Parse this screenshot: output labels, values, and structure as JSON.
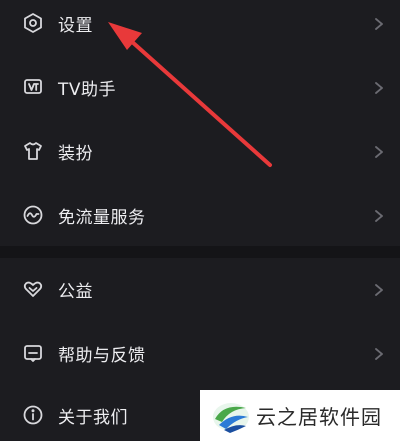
{
  "menu": {
    "items": [
      {
        "label": "设置",
        "icon": "gear-hexagon-icon"
      },
      {
        "label": "TV助手",
        "icon": "tv-icon"
      },
      {
        "label": "装扮",
        "icon": "tshirt-icon"
      },
      {
        "label": "免流量服务",
        "icon": "traffic-wave-icon"
      },
      {
        "label": "公益",
        "icon": "heart-icon"
      },
      {
        "label": "帮助与反馈",
        "icon": "feedback-icon"
      },
      {
        "label": "关于我们",
        "icon": "info-icon"
      }
    ]
  },
  "annotation": {
    "arrow_color": "#e8393a"
  },
  "watermark": {
    "text": "云之居软件园"
  },
  "colors": {
    "background": "#1c1c20",
    "divider": "#141417",
    "text": "#ededf0",
    "chevron": "#6b6b72"
  }
}
